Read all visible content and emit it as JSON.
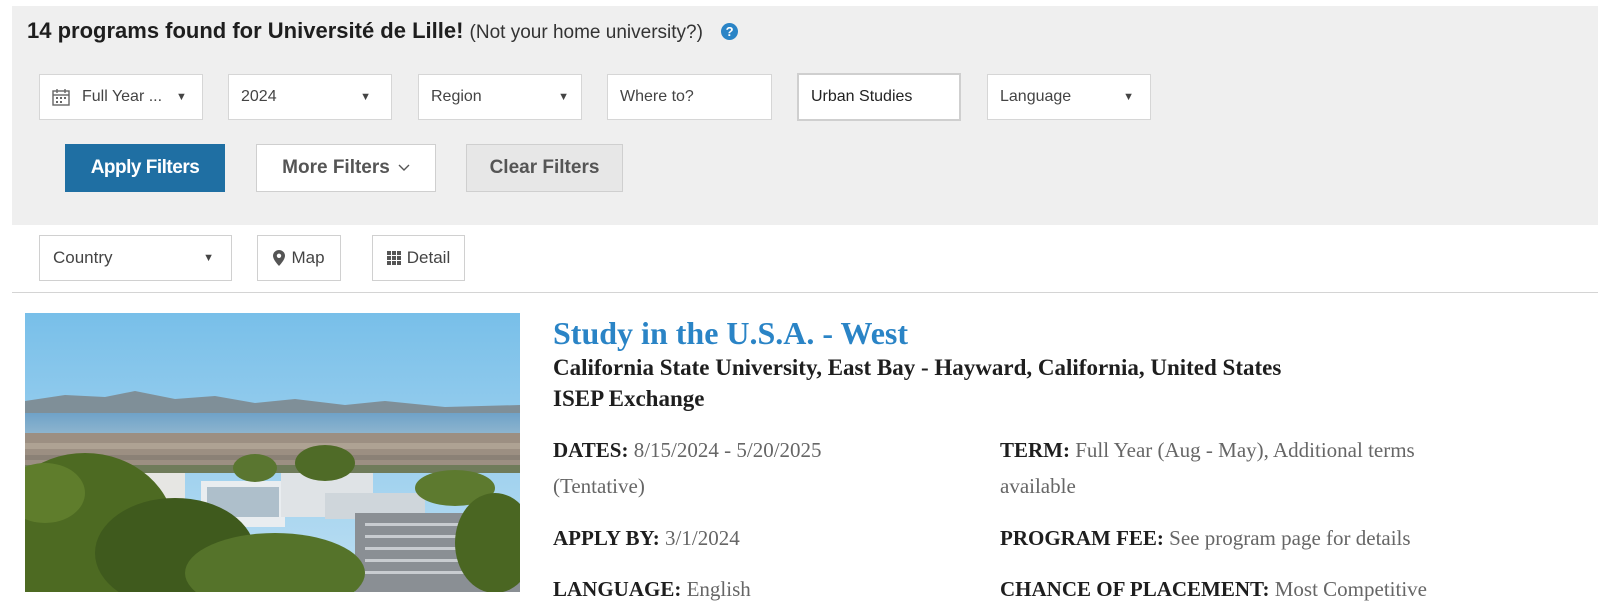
{
  "header": {
    "count_text": "14 programs found for Université de Lille!",
    "not_home_text": "(Not your home university?)",
    "help_glyph": "?"
  },
  "filters": {
    "term": {
      "value": "Full Year ..."
    },
    "year": {
      "value": "2024"
    },
    "region": {
      "placeholder": "Region"
    },
    "where": {
      "placeholder": "Where to?"
    },
    "field_of_study": {
      "value": "Urban Studies"
    },
    "language": {
      "placeholder": "Language"
    },
    "apply_label": "Apply Filters",
    "more_label": "More Filters",
    "clear_label": "Clear Filters"
  },
  "toolbar": {
    "country_placeholder": "Country",
    "map_label": "Map",
    "detail_label": "Detail"
  },
  "result": {
    "title": "Study in the U.S.A. - West",
    "university": "California State University, East Bay - Hayward, California, United States",
    "program_type": "ISEP Exchange",
    "dates_label": "DATES:",
    "dates_value": "8/15/2024 - 5/20/2025",
    "dates_note": "(Tentative)",
    "term_label": "TERM:",
    "term_value": "Full Year (Aug - May), Additional terms",
    "term_value_2": "available",
    "apply_by_label": "APPLY BY:",
    "apply_by_value": "3/1/2024",
    "fee_label": "PROGRAM FEE:",
    "fee_value": "See program page for details",
    "language_label": "LANGUAGE:",
    "language_value": "English",
    "chance_label": "CHANCE OF PLACEMENT:",
    "chance_value": "Most Competitive"
  },
  "colors": {
    "accent": "#2a84c6",
    "primary_button": "#1f6fa3",
    "filter_panel": "#efefef"
  },
  "icons": {
    "term": "calendar-icon",
    "help": "help-icon",
    "map": "map-pin-icon",
    "detail": "grid-icon",
    "dropdown": "caret-down-icon"
  }
}
